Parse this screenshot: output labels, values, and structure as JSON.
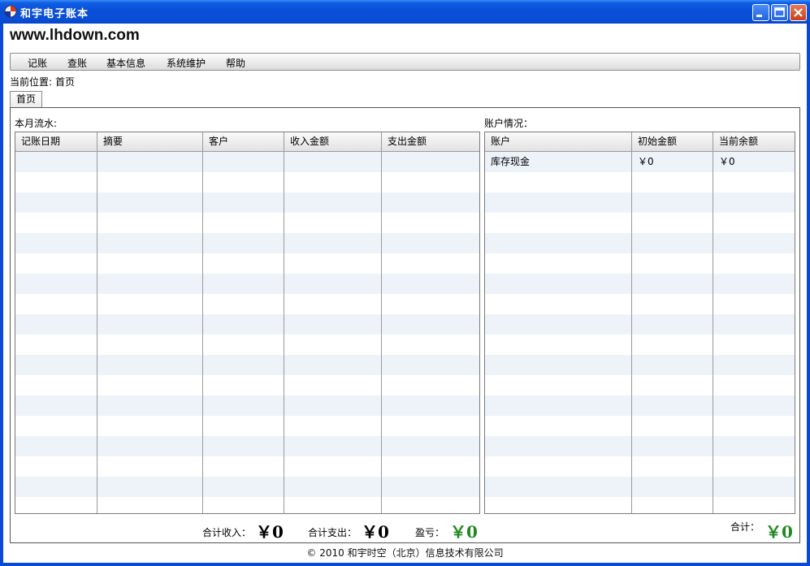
{
  "window": {
    "title": "和宇电子账本"
  },
  "brand": "www.lhdown.com",
  "menu": [
    "记账",
    "查账",
    "基本信息",
    "系统维护",
    "帮助"
  ],
  "breadcrumb": {
    "label": "当前位置:",
    "value": "首页"
  },
  "tab": "首页",
  "left": {
    "title": "本月流水:",
    "columns": [
      "记账日期",
      "摘要",
      "客户",
      "收入金额",
      "支出金额"
    ],
    "rows": []
  },
  "right": {
    "title": "账户情况：",
    "columns": [
      "账户",
      "初始金额",
      "当前余额"
    ],
    "rows": [
      {
        "account": "库存现金",
        "initial": "￥0",
        "current": "￥0"
      }
    ]
  },
  "totals": {
    "income_label": "合计收入：",
    "income_value": "￥0",
    "expense_label": "合计支出：",
    "expense_value": "￥0",
    "profit_label": "盈亏：",
    "profit_value": "￥0",
    "sum_label": "合计：",
    "sum_value": "￥0"
  },
  "footer": "© 2010 和宇时空（北京）信息技术有限公司",
  "colors": {
    "titlebar": "#0a4ed8",
    "stripe": "#eef3fa",
    "total_green": "#1f8a1f"
  }
}
